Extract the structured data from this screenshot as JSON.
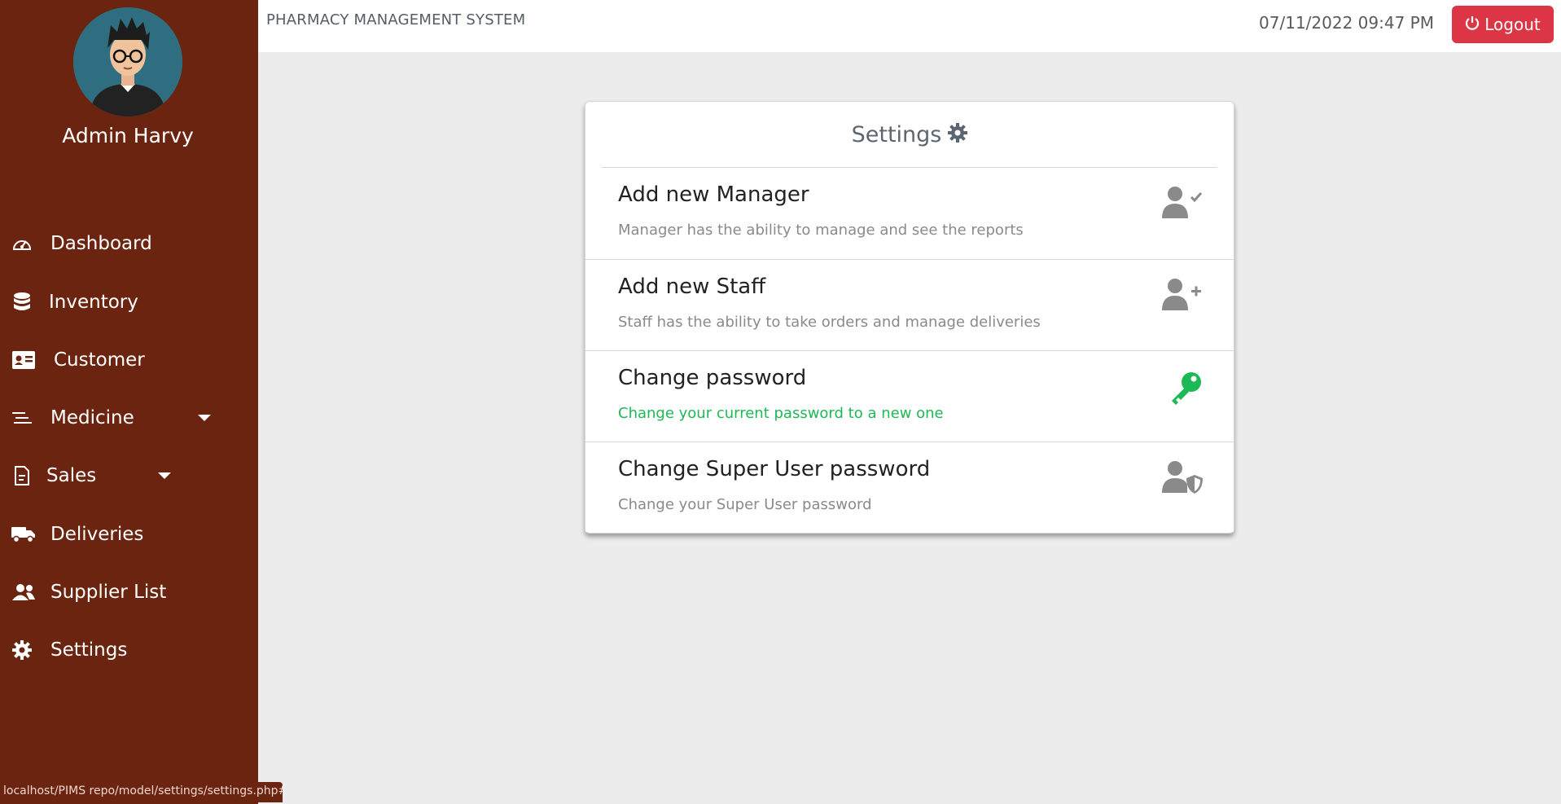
{
  "user": {
    "name": "Admin Harvy"
  },
  "sidebar": {
    "items": [
      {
        "label": "Dashboard",
        "icon": "gauge-icon"
      },
      {
        "label": "Inventory",
        "icon": "database-icon"
      },
      {
        "label": "Customer",
        "icon": "id-card-icon"
      },
      {
        "label": "Medicine",
        "icon": "bars-icon",
        "has_dropdown": true
      },
      {
        "label": "Sales",
        "icon": "document-icon",
        "has_dropdown": true
      },
      {
        "label": "Deliveries",
        "icon": "truck-icon"
      },
      {
        "label": "Supplier List",
        "icon": "users-icon"
      },
      {
        "label": "Settings",
        "icon": "gear-icon"
      }
    ]
  },
  "topbar": {
    "title": "PHARMACY MANAGEMENT SYSTEM",
    "datetime": "07/11/2022 09:47 PM",
    "logout_label": "Logout"
  },
  "settings_card": {
    "title": "Settings",
    "rows": [
      {
        "title": "Add new Manager",
        "desc": "Manager has the ability to manage and see the reports",
        "icon": "user-check-icon"
      },
      {
        "title": "Add new Staff",
        "desc": "Staff has the ability to take orders and manage deliveries",
        "icon": "user-plus-icon"
      },
      {
        "title": "Change password",
        "desc": "Change your current password to a new one",
        "icon": "key-icon",
        "highlight": true
      },
      {
        "title": "Change Super User password",
        "desc": "Change your Super User password",
        "icon": "user-shield-icon"
      }
    ]
  },
  "colors": {
    "sidebar_bg": "#6b240f",
    "logout_bg": "#dc3545",
    "highlight_green": "#1db954",
    "icon_gray": "#8a8a8a"
  },
  "statusbar": {
    "url": "localhost/PIMS repo/model/settings/settings.php#"
  }
}
